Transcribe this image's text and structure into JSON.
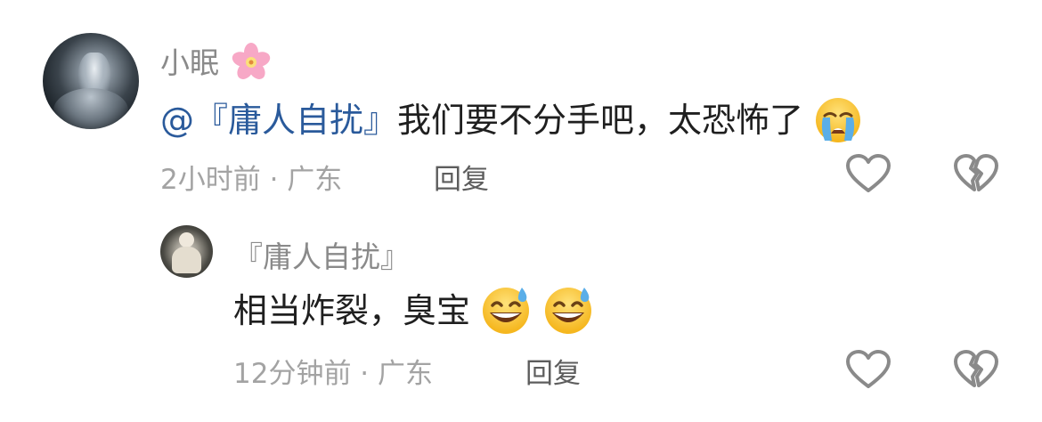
{
  "comments": [
    {
      "author": "小眠",
      "mention": "@『庸人自扰』",
      "text": "我们要不分手吧，太恐怖了",
      "time": "2小时前",
      "location": "广东",
      "reply_label": "回复"
    }
  ],
  "reply": {
    "author": "『庸人自扰』",
    "text": "相当炸裂，臭宝",
    "time": "12分钟前",
    "location": "广东",
    "reply_label": "回复"
  },
  "icons": {
    "author_badge": "cherry-blossom-icon",
    "comment_emoji": "loudly-crying-face-icon",
    "reply_emojis": [
      "grinning-face-with-sweat-icon",
      "grinning-face-with-sweat-icon"
    ],
    "like": "heart-outline-icon",
    "dislike": "broken-heart-outline-icon"
  },
  "colors": {
    "mention": "#2a5a9b",
    "meta": "#a3a3a3",
    "name": "#8a8a8a"
  }
}
